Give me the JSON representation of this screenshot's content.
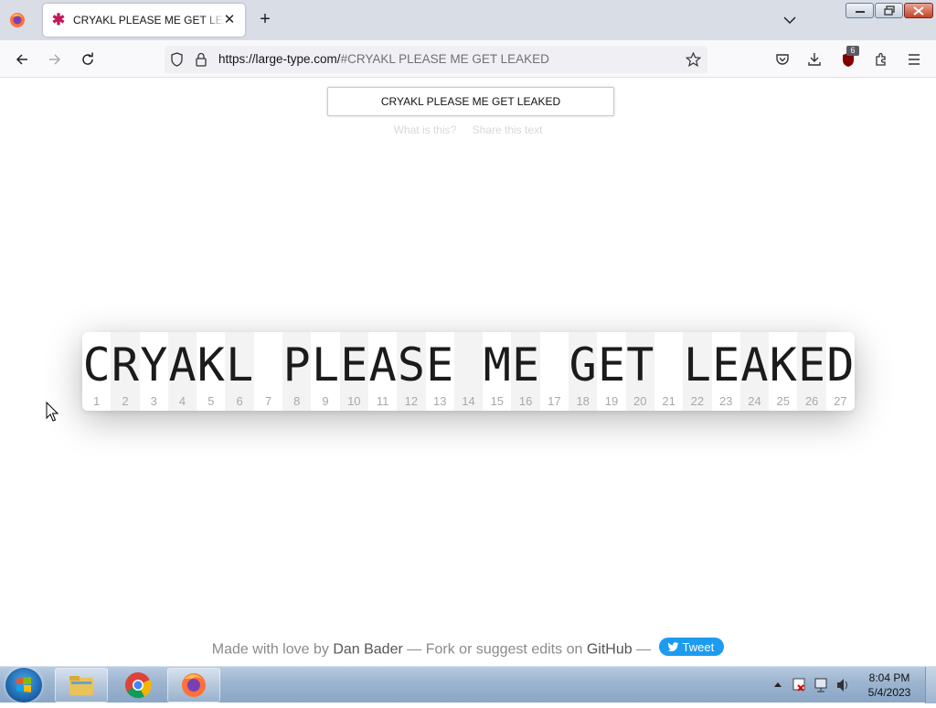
{
  "browser": {
    "tab_title": "CRYAKL PLEASE ME GET LEAKED",
    "url_host": "https://large-type.com/",
    "url_rest": "#CRYAKL PLEASE ME GET LEAKED",
    "ublock_badge": "6"
  },
  "page": {
    "input_value": "CRYAKL PLEASE ME GET LEAKED",
    "help_link_what": "What is this?",
    "help_link_share": "Share this text",
    "large_text_chars": [
      "C",
      "R",
      "Y",
      "A",
      "K",
      "L",
      " ",
      "P",
      "L",
      "E",
      "A",
      "S",
      "E",
      " ",
      "M",
      "E",
      " ",
      "G",
      "E",
      "T",
      " ",
      "L",
      "E",
      "A",
      "K",
      "E",
      "D"
    ],
    "large_text_numbers": [
      "1",
      "2",
      "3",
      "4",
      "5",
      "6",
      "7",
      "8",
      "9",
      "10",
      "11",
      "12",
      "13",
      "14",
      "15",
      "16",
      "17",
      "18",
      "19",
      "20",
      "21",
      "22",
      "23",
      "24",
      "25",
      "26",
      "27"
    ],
    "footer": {
      "made_with": "Made with love by",
      "author": "Dan Bader",
      "dash1": "—",
      "fork_text": "Fork or suggest edits on",
      "github": "GitHub",
      "dash2": "—",
      "tweet": "Tweet"
    }
  },
  "taskbar": {
    "items": [
      "windows-explorer",
      "chrome",
      "firefox"
    ],
    "time": "8:04 PM",
    "date": "5/4/2023"
  },
  "colors": {
    "tweet_blue": "#1d9bf0",
    "tab_favicon": "#c2185b"
  }
}
